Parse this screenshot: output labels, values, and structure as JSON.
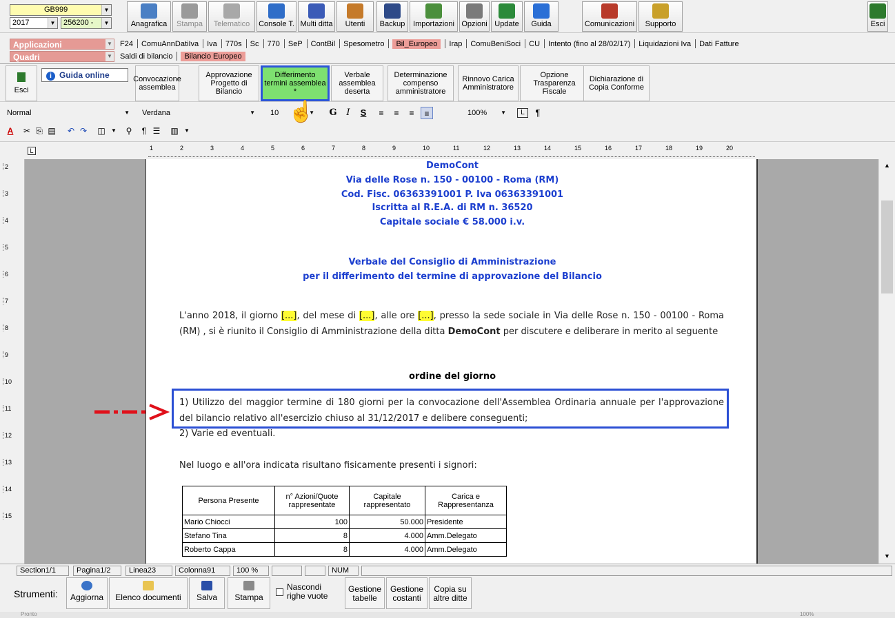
{
  "topbar": {
    "company_code": "GB999",
    "year": "2017",
    "company_id": "256200 -",
    "buttons": [
      {
        "label": "Anagrafica",
        "icon": "anagrafica-icon",
        "dim": false
      },
      {
        "label": "Stampa",
        "icon": "printer-icon",
        "dim": true
      },
      {
        "label": "Telematico",
        "icon": "telematico-icon",
        "dim": true
      },
      {
        "label": "Console T.",
        "icon": "console-icon",
        "dim": false
      },
      {
        "label": "Multi ditta",
        "icon": "multi-ditta-icon",
        "dim": false
      },
      {
        "label": "Utenti",
        "icon": "users-icon",
        "dim": false
      },
      {
        "label": "Backup",
        "icon": "backup-icon",
        "dim": false
      },
      {
        "label": "Importazioni",
        "icon": "import-icon",
        "dim": false
      },
      {
        "label": "Opzioni",
        "icon": "options-icon",
        "dim": false
      },
      {
        "label": "Update",
        "icon": "update-icon",
        "dim": false
      },
      {
        "label": "Guida",
        "icon": "help-icon",
        "dim": false
      },
      {
        "label": "Comunicazioni",
        "icon": "communications-icon",
        "dim": false
      },
      {
        "label": "Supporto",
        "icon": "support-icon",
        "dim": false
      },
      {
        "label": "Esci",
        "icon": "exit-icon",
        "dim": false
      }
    ]
  },
  "menu1": {
    "label": "Applicazioni",
    "items": [
      "F24",
      "ComuAnnDatiIva",
      "Iva",
      "770s",
      "Sc",
      "770",
      "SeP",
      "ContBil",
      "Spesometro",
      "Bil_Europeo",
      "Irap",
      "ComuBeniSoci",
      "CU",
      "Intento (fino al 28/02/17)",
      "Liquidazioni Iva",
      "Dati Fatture"
    ],
    "active": "Bil_Europeo"
  },
  "menu2": {
    "label": "Quadri",
    "items": [
      "Saldi di bilancio",
      "Bilancio Europeo"
    ],
    "active": "Bilancio Europeo"
  },
  "ribbon": {
    "exit": "Esci",
    "guida": "Guida online",
    "buttons": [
      "Convocazione assemblea",
      "Approvazione Progetto di Bilancio",
      "Differimento termini assemblea *",
      "Verbale assemblea deserta",
      "Determinazione compenso amministratore",
      "Rinnovo Carica Amministratore",
      "Opzione Trasparenza Fiscale",
      "Dichiarazione di Copia Conforme"
    ],
    "selected": "Differimento termini assemblea *"
  },
  "format": {
    "style": "Normal",
    "font": "Verdana",
    "size": "10",
    "zoom": "100%"
  },
  "ruler": {
    "box": "L",
    "marks": [
      "1",
      "2",
      "3",
      "4",
      "5",
      "6",
      "7",
      "8",
      "9",
      "10",
      "11",
      "12",
      "13",
      "14",
      "15",
      "16",
      "17",
      "18",
      "19",
      "20"
    ]
  },
  "document": {
    "header": [
      "DemoCont",
      "Via delle Rose n. 150 - 00100 - Roma (RM)",
      "Cod. Fisc. 06363391001 P. Iva 06363391001",
      "Iscritta al R.E.A. di RM n. 36520",
      "Capitale sociale € 58.000 i.v."
    ],
    "title1": "Verbale del Consiglio di Amministrazione",
    "title2": "per il differimento del termine di approvazione del Bilancio",
    "para_a": "L'anno 2018, il giorno ",
    "placeholder": "[...]",
    "para_b": ", del mese di ",
    "para_c": ", alle ore ",
    "para_d": ", presso la sede sociale in Via delle Rose n. 150 - 00100 - Roma (RM) , si è riunito il Consiglio di Amministrazione della ditta ",
    "company": "DemoCont",
    "para_e": " per discutere e deliberare in merito al seguente",
    "ordine": "ordine del giorno",
    "item1": "1) Utilizzo del maggior termine di 180 giorni per la convocazione dell'Assemblea Ordinaria annuale per l'approvazione del bilancio relativo all'esercizio chiuso al 31/12/2017 e delibere conseguenti;",
    "item2": "2) Varie ed eventuali.",
    "presenti": "Nel luogo e all'ora indicata risultano fisicamente presenti i signori:",
    "table": {
      "headers": [
        "Persona Presente",
        "n° Azioni/Quote rappresentate",
        "Capitale rappresentato",
        "Carica e Rappresentanza"
      ],
      "rows": [
        [
          "Mario Chiocci",
          "100",
          "50.000",
          "Presidente"
        ],
        [
          "Stefano Tina",
          "8",
          "4.000",
          "Amm.Delegato"
        ],
        [
          "Roberto Cappa",
          "8",
          "4.000",
          "Amm.Delegato"
        ]
      ]
    }
  },
  "status": {
    "section": "Section1/1",
    "page": "Pagina1/2",
    "line": "Linea23",
    "column": "Colonna91",
    "zoom": "100 %",
    "num": "NUM"
  },
  "tools": {
    "label": "Strumenti:",
    "buttons": [
      "Aggiorna",
      "Elenco documenti",
      "Salva",
      "Stampa"
    ],
    "checkbox": "Nascondi righe vuote",
    "gestione_tabelle": "Gestione tabelle",
    "gestione_costanti": "Gestione costanti",
    "copia": "Copia su altre ditte"
  },
  "bottom": {
    "left": "Pronto",
    "right": "100%"
  }
}
